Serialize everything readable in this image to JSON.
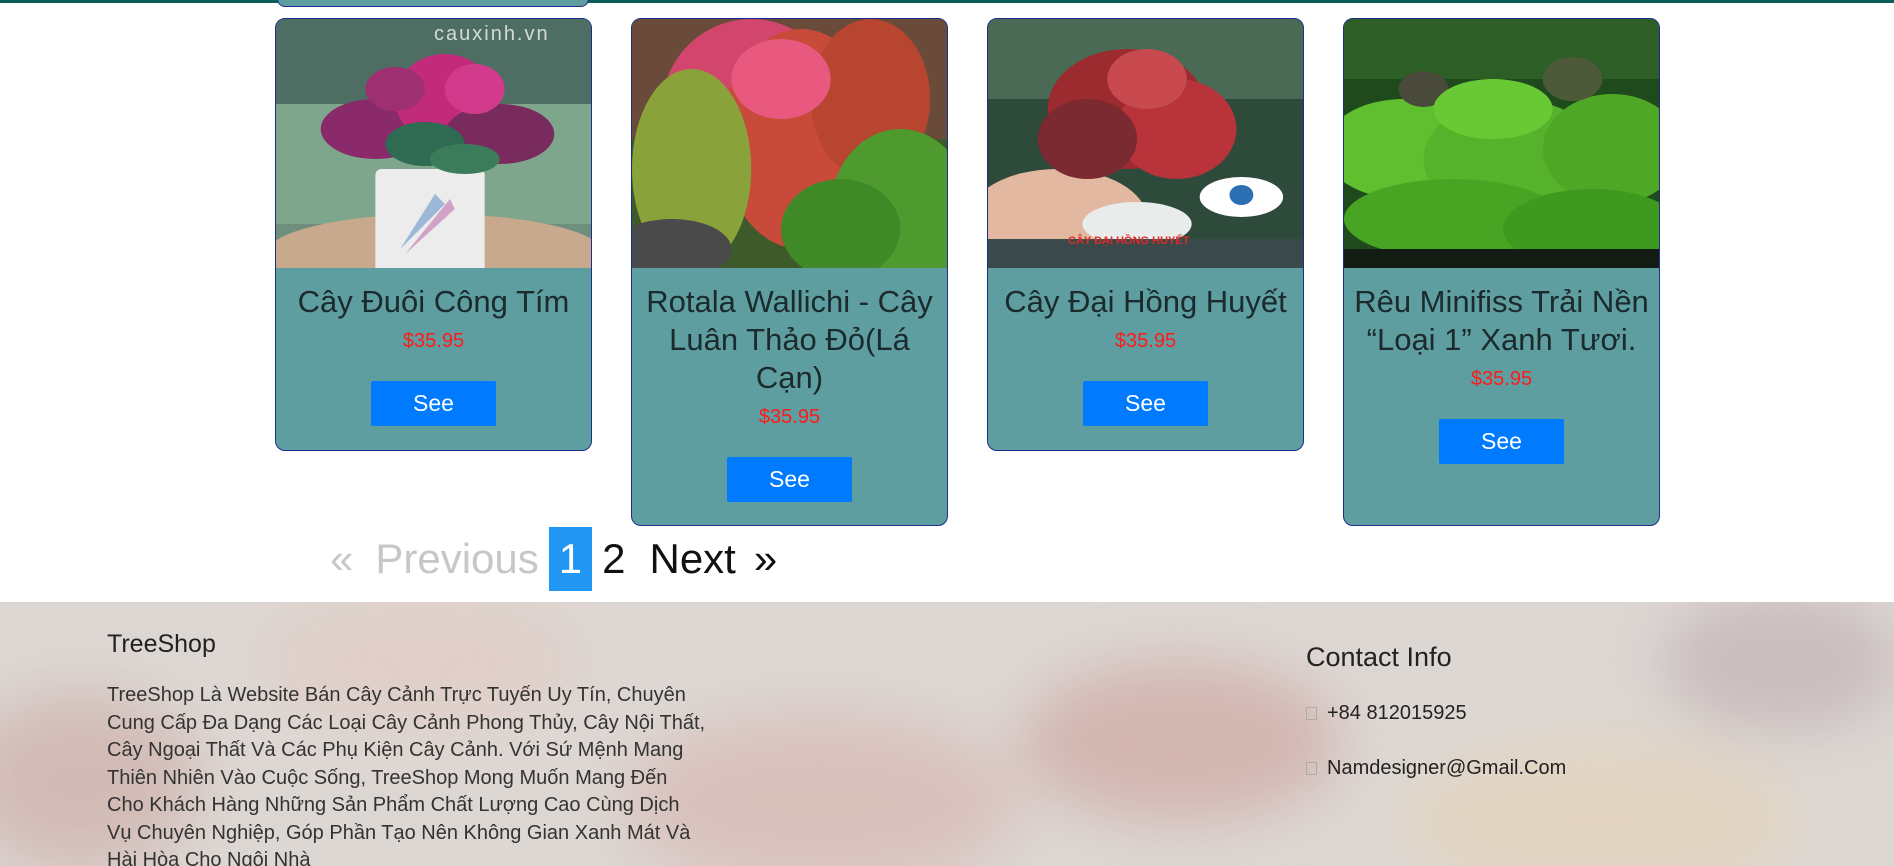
{
  "products": [
    {
      "name": "Cây Đuôi Công Tím",
      "price": "$35.95",
      "button": "See",
      "watermark": "cauxinh.vn"
    },
    {
      "name": "Rotala Wallichi - Cây Luân Thảo Đỏ(Lá Cạn)",
      "price": "$35.95",
      "button": "See"
    },
    {
      "name": "Cây Đại Hồng Huyết",
      "price": "$35.95",
      "button": "See",
      "image_caption": "CÂY ĐẠI HỒNG HUYẾT"
    },
    {
      "name": "Rêu Minifiss Trải Nền “Loại 1” Xanh Tươi.",
      "price": "$35.95",
      "button": "See"
    }
  ],
  "pagination": {
    "prev_arrow": "«",
    "prev": "Previous",
    "pages": [
      "1",
      "2"
    ],
    "current": "1",
    "next": "Next",
    "next_arrow": "»"
  },
  "footer": {
    "brand": "TreeShop",
    "description": "TreeShop Là Website Bán Cây Cảnh Trực Tuyến Uy Tín, Chuyên Cung Cấp Đa Dạng Các Loại Cây Cảnh Phong Thủy, Cây Nội Thất, Cây Ngoại Thất Và Các Phụ Kiện Cây Cảnh. Với Sứ Mệnh Mang Thiên Nhiên Vào Cuộc Sống, TreeShop Mong Muốn Mang Đến Cho Khách Hàng Những Sản Phẩm Chất Lượng Cao Cùng Dịch Vụ Chuyên Nghiệp, Góp Phần Tạo Nên Không Gian Xanh Mát Và Hài Hòa Cho Ngôi Nhà",
    "contact_title": "Contact Info",
    "phone": "+84 812015925",
    "phone_icon": "phone-icon",
    "email": "Namdesigner@Gmail.Com",
    "email_icon": "envelope-icon"
  },
  "colors": {
    "card_bg": "#5f9ea0",
    "card_border": "#1c2f8c",
    "price": "#ff1a1a",
    "button": "#007bff",
    "page_active": "#2196f3",
    "top_line": "#0b5d57"
  }
}
